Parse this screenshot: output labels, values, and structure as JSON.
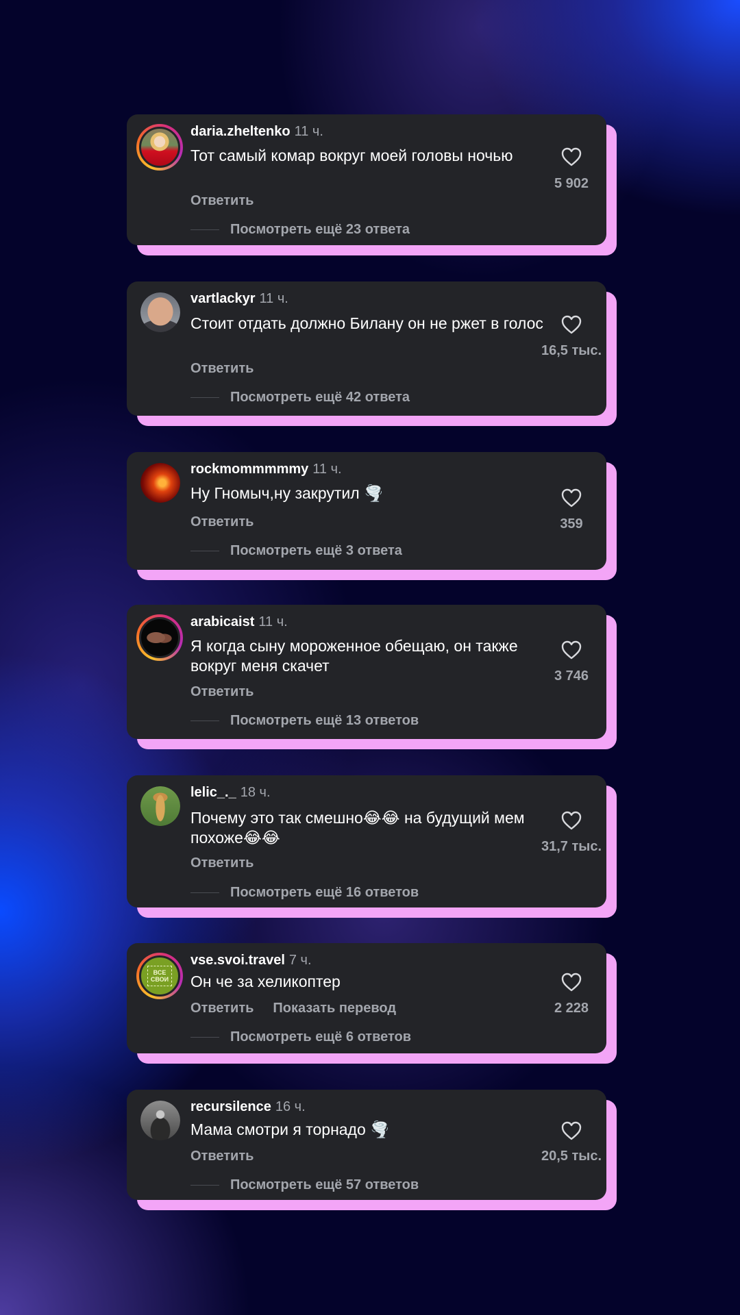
{
  "comments": [
    {
      "username": "daria.zheltenko",
      "time": "11 ч.",
      "text": "Тот самый комар вокруг моей головы ночью",
      "reply": "Ответить",
      "more_replies": "Посмотреть ещё 23 ответа",
      "likes": "5 902",
      "avatar": "woman-red-dress-avatar",
      "ring": true
    },
    {
      "username": "vartlackyr",
      "time": "11 ч.",
      "text": "Стоит отдать должно Билану он не ржет в голос",
      "reply": "Ответить",
      "more_replies": "Посмотреть ещё 42 ответа",
      "likes": "16,5 тыс.",
      "avatar": "man-portrait-avatar",
      "ring": false
    },
    {
      "username": "rockmommmmmy",
      "time": "11 ч.",
      "text": "Ну Гномыч,ну закрутил 🌪️",
      "reply": "Ответить",
      "more_replies": "Посмотреть ещё 3 ответа",
      "likes": "359",
      "avatar": "red-fire-avatar",
      "ring": false
    },
    {
      "username": "arabicaist",
      "time": "11 ч.",
      "text": "Я когда сыну мороженное обещаю, он также вокруг меня скачет",
      "reply": "Ответить",
      "more_replies": "Посмотреть ещё 13 ответов",
      "likes": "3 746",
      "avatar": "dark-hands-avatar",
      "ring": true
    },
    {
      "username": "lelic_._",
      "time": "18 ч.",
      "text": "Почему это так смешно😂😂 на будущий мем похоже😂😂",
      "reply": "Ответить",
      "more_replies": "Посмотреть ещё 16 ответов",
      "likes": "31,7 тыс.",
      "avatar": "giraffe-avatar",
      "ring": false
    },
    {
      "username": "vse.svoi.travel",
      "time": "7 ч.",
      "text": "Он че за хеликоптер",
      "reply": "Ответить",
      "translate": "Показать перевод",
      "more_replies": "Посмотреть ещё 6 ответов",
      "likes": "2 228",
      "avatar": "vse-svoi-logo-avatar",
      "avatar_text": "ВСЕ СВОИ",
      "ring": true
    },
    {
      "username": "recursilence",
      "time": "16 ч.",
      "text": "Мама смотри я торнадо 🌪️",
      "reply": "Ответить",
      "more_replies": "Посмотреть ещё 57 ответов",
      "likes": "20,5 тыс.",
      "avatar": "person-dark-avatar",
      "ring": false
    }
  ],
  "colors": {
    "card": "#232428",
    "card_shadow": "#f3a5f7",
    "muted_text": "#a3a6ad",
    "background": "#04032b"
  }
}
